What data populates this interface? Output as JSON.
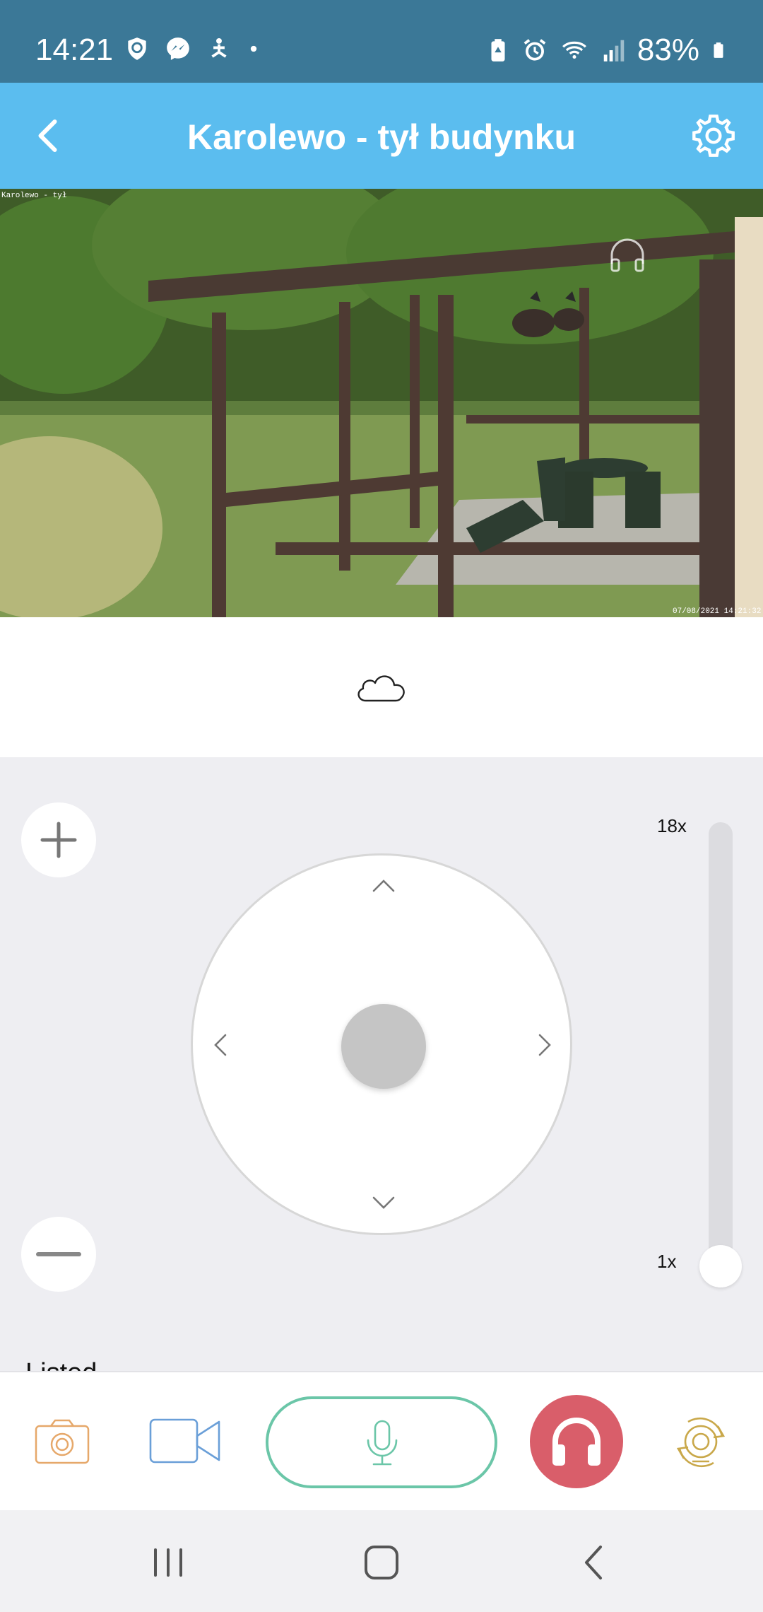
{
  "status_bar": {
    "time": "14:21",
    "battery": "83%",
    "left_icons": [
      "vpn-shield-icon",
      "messenger-icon",
      "yoga-app-icon",
      "dot-icon"
    ],
    "right_icons": [
      "battery-saver-icon",
      "alarm-icon",
      "wifi-icon",
      "signal-icon",
      "battery-icon"
    ]
  },
  "app_bar": {
    "title": "Karolewo - tył budynku",
    "back_icon": "chevron-left-icon",
    "settings_icon": "gear-icon"
  },
  "video": {
    "overlay_label": "Karolewo - tył",
    "overlay_timestamp": "07/08/2021 14:21:32",
    "listen_indicator_icon": "headphones-icon"
  },
  "cloud": {
    "icon": "cloud-icon"
  },
  "ptz": {
    "zoom_in_icon": "plus-icon",
    "zoom_out_icon": "minus-icon",
    "zoom_max_label": "18x",
    "zoom_min_label": "1x",
    "zoom_level_fraction": 0.0,
    "partial_text": "Listed"
  },
  "toolbar": {
    "snapshot_icon": "camera-icon",
    "record_icon": "video-camera-icon",
    "talk_icon": "microphone-icon",
    "listen_icon": "headphones-icon",
    "rotate_icon": "rotate-camera-icon"
  },
  "colors": {
    "status_bar": "#3b7897",
    "app_bar": "#5bbdef",
    "mic_accent": "#6bc6a8",
    "listen_accent": "#d95e6a",
    "snapshot_accent": "#e6a86a",
    "record_accent": "#6a9fd8",
    "rotate_accent": "#c9a84a"
  },
  "nav": {
    "recent_icon": "recent-apps-icon",
    "home_icon": "home-icon",
    "back_icon": "nav-back-icon"
  }
}
